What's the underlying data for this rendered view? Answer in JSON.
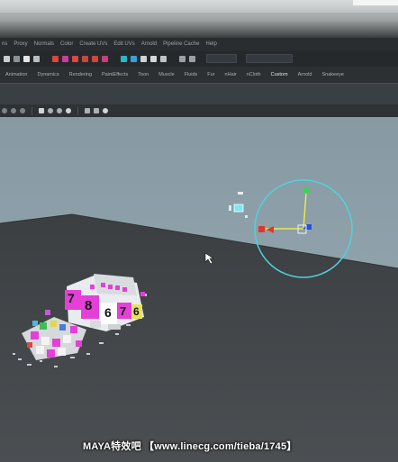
{
  "menu": {
    "items": [
      "ns",
      "Proxy",
      "Normals",
      "Color",
      "Create UVs",
      "Edit UVs",
      "Arnold",
      "Pipeline Cache",
      "Help"
    ]
  },
  "shelf": {
    "tabs": [
      "Animation",
      "Dynamics",
      "Rendering",
      "PaintEffects",
      "Toon",
      "Muscle",
      "Fluids",
      "Fur",
      "nHair",
      "nCloth",
      "Custom",
      "Arnold",
      "Snakeeye"
    ]
  },
  "scene": {
    "dice_numbers": [
      "7",
      "8",
      "6",
      "7",
      "6"
    ]
  },
  "watermark": {
    "text": "MAYA特效吧  【www.linecg.com/tieba/1745】"
  },
  "colors": {
    "viewport_bg": "#8fa2ab",
    "ground": "#434649",
    "manipulator_ring": "#4fd2e0",
    "axis_x": "#e0342c",
    "axis_y": "#3fd25a",
    "axis_z": "#2a4fd6",
    "dice_magenta": "#e43fd6"
  },
  "icons": {
    "status_icons": [
      "move-tool-icon",
      "select-icon",
      "lasso-icon",
      "paint-icon",
      "snap-grid-icon",
      "snap-curve-icon",
      "snap-point-icon",
      "render-icon",
      "ipr-icon",
      "render-settings-icon"
    ],
    "manipulator": "move-manipulator-icon",
    "cursor": "mouse-cursor-icon"
  }
}
